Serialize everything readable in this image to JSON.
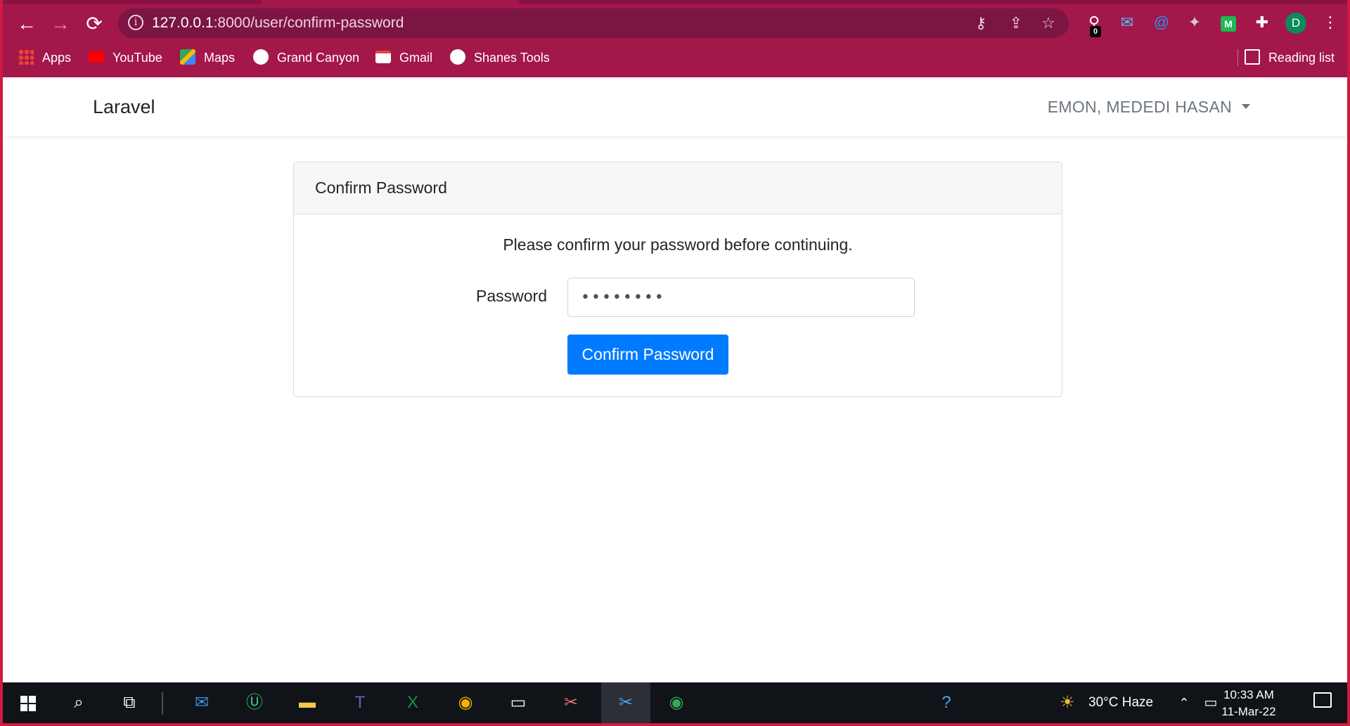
{
  "browser": {
    "url_host": "127.0.0.1",
    "url_path": ":8000/user/confirm-password",
    "profile_initial": "D",
    "extension_badge": "0",
    "icons": {
      "back": "arrow-left-icon",
      "forward": "arrow-right-icon",
      "reload": "reload-icon",
      "info": "info-icon",
      "key": "key-icon",
      "share": "share-icon",
      "star": "star-icon",
      "extensions": "puzzle-icon",
      "menu": "kebab-menu-icon"
    },
    "colors": {
      "frame": "#a3174b",
      "omnibox": "#7c1542"
    }
  },
  "bookmarks": {
    "items": [
      {
        "label": "Apps"
      },
      {
        "label": "YouTube"
      },
      {
        "label": "Maps"
      },
      {
        "label": "Grand Canyon"
      },
      {
        "label": "Gmail"
      },
      {
        "label": "Shanes Tools"
      }
    ],
    "reading_list": "Reading list"
  },
  "navbar": {
    "brand": "Laravel",
    "user": "EMON, MEDEDI HASAN"
  },
  "card": {
    "header": "Confirm Password",
    "message": "Please confirm your password before continuing.",
    "password_label": "Password",
    "password_value": "••••••••",
    "submit_label": "Confirm Password",
    "accent": "#007bff"
  },
  "taskbar": {
    "weather": "30°C  Haze",
    "time": "10:33 AM",
    "date": "11-Mar-22"
  }
}
